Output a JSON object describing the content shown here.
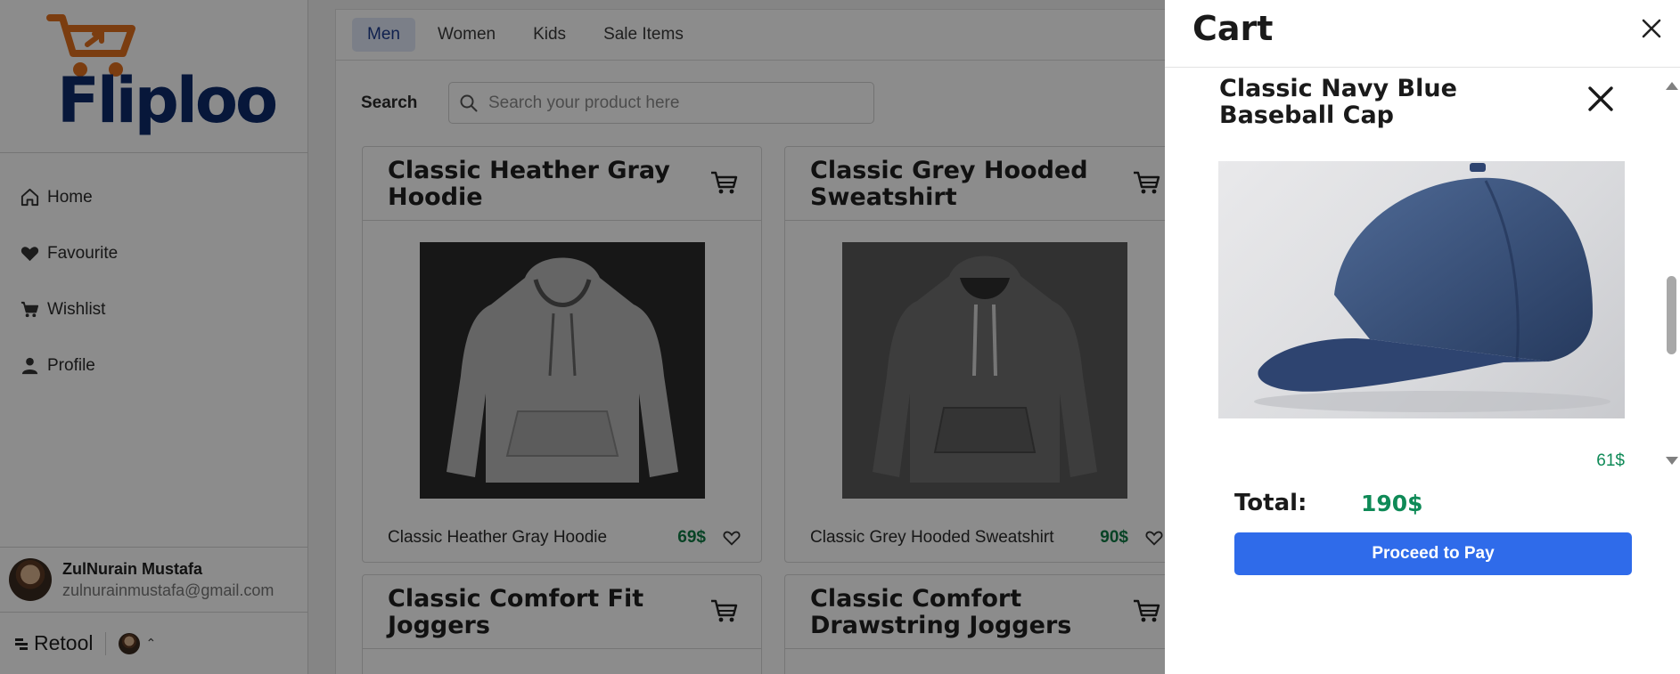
{
  "app": {
    "logo_text": "Fliploo",
    "brand_colors": {
      "navy": "#0d2a6b",
      "orange": "#e0701e"
    }
  },
  "sidebar": {
    "items": [
      {
        "label": "Home",
        "icon": "home-icon"
      },
      {
        "label": "Favourite",
        "icon": "heart-icon"
      },
      {
        "label": "Wishlist",
        "icon": "cart-icon"
      },
      {
        "label": "Profile",
        "icon": "user-icon"
      }
    ],
    "user": {
      "name": "ZulNurain Mustafa",
      "email": "zulnurainmustafa@gmail.com"
    },
    "footer": {
      "brand": "Retool"
    }
  },
  "tabs": [
    {
      "label": "Men",
      "active": true
    },
    {
      "label": "Women",
      "active": false
    },
    {
      "label": "Kids",
      "active": false
    },
    {
      "label": "Sale Items",
      "active": false
    }
  ],
  "search": {
    "label": "Search",
    "placeholder": "Search your product here"
  },
  "products": [
    {
      "title": "Classic Heather Gray Hoodie",
      "name": "Classic Heather Gray Hoodie",
      "price": "69$"
    },
    {
      "title": "Classic Grey Hooded Sweatshirt",
      "name": "Classic Grey Hooded Sweatshirt",
      "price": "90$"
    },
    {
      "title": "Classic Comfort Fit Joggers"
    },
    {
      "title": "Classic Comfort Drawstring Joggers"
    }
  ],
  "cart": {
    "title": "Cart",
    "item": {
      "title": "Classic Navy Blue Baseball Cap",
      "price": "61$"
    },
    "total_label": "Total:",
    "total_value": "190$",
    "pay_label": "Proceed to Pay",
    "colors": {
      "price": "#0f8a57",
      "button": "#2f6bea"
    }
  }
}
